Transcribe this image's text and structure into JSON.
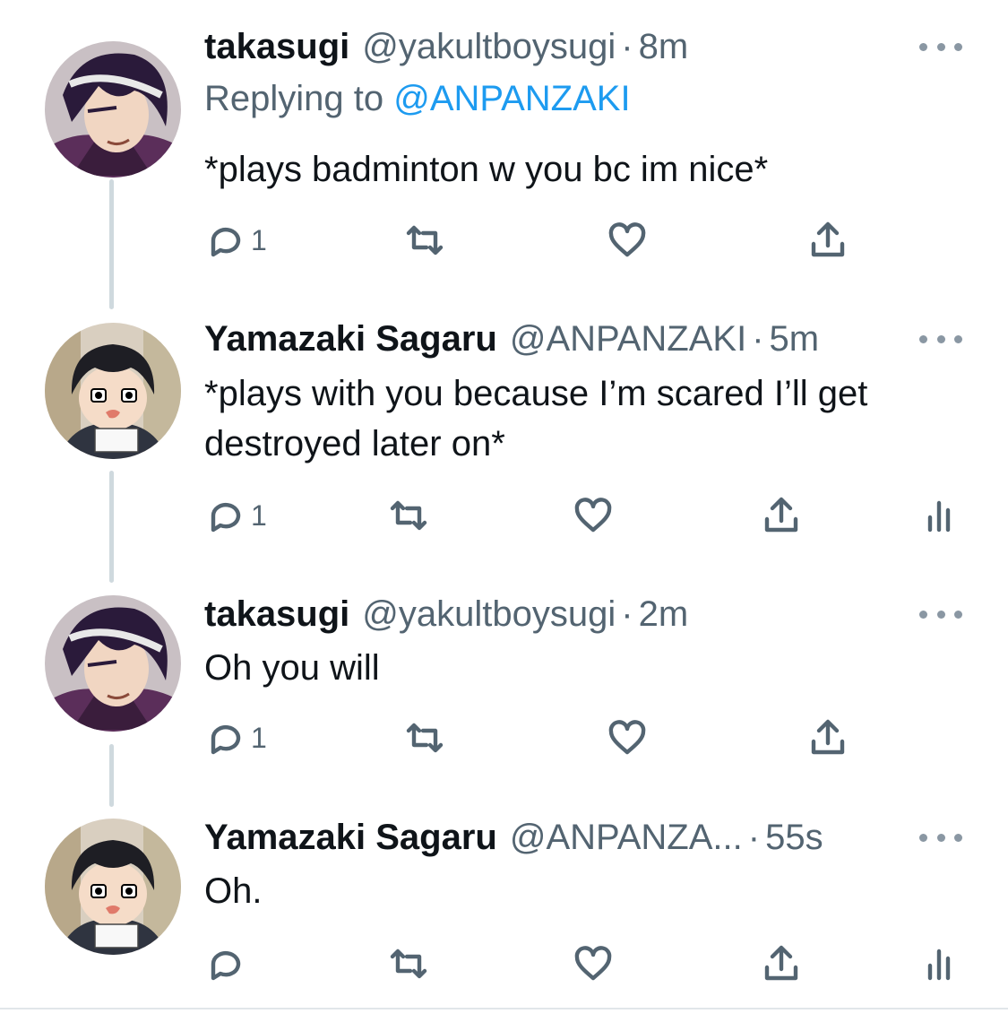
{
  "tweets": [
    {
      "name": "takasugi",
      "handle": "@yakultboysugi",
      "dot": "·",
      "time": "8m",
      "reply_prefix": "Replying to ",
      "reply_to": "@ANPANZAKI",
      "text": "*plays badminton w you bc im nice*",
      "reply_count": "1",
      "avatar": "avatar-takasugi"
    },
    {
      "name": "Yamazaki Sagaru",
      "handle": "@ANPANZAKI",
      "dot": "·",
      "time": "5m",
      "text": "*plays with you because I’m scared I’ll get destroyed later on*",
      "reply_count": "1",
      "avatar": "avatar-yamazaki"
    },
    {
      "name": "takasugi",
      "handle": "@yakultboysugi",
      "dot": "·",
      "time": "2m",
      "text": "Oh you will",
      "reply_count": "1",
      "avatar": "avatar-takasugi"
    },
    {
      "name": "Yamazaki Sagaru",
      "handle": "@ANPANZA...",
      "dot": "·",
      "time": "55s",
      "text": "Oh.",
      "reply_count": "",
      "avatar": "avatar-yamazaki"
    }
  ],
  "icons": {
    "reply": "reply-icon",
    "retweet": "retweet-icon",
    "like": "heart-icon",
    "share": "share-icon",
    "analytics": "analytics-icon",
    "more": "more-icon"
  },
  "colors": {
    "link": "#1d9bf0",
    "secondary_text": "#536471",
    "thread_line": "#cfd9de"
  }
}
